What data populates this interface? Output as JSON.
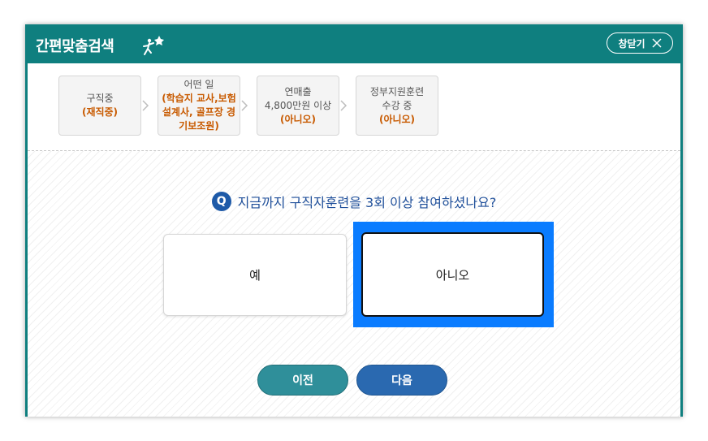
{
  "header": {
    "title": "간편맞춤검색",
    "close_label": "창닫기"
  },
  "steps": [
    {
      "lines": [
        "구직중"
      ],
      "value": "(재직중)"
    },
    {
      "lines": [
        "어떤 일"
      ],
      "value_lines": [
        "(학습지 교사,보험",
        "설계사, 골프장 경",
        "기보조원)"
      ]
    },
    {
      "lines": [
        "연매출",
        "4,800만원 이상"
      ],
      "value": "(아니오)"
    },
    {
      "lines": [
        "정부지원훈련",
        "수강 중"
      ],
      "value": "(아니오)"
    }
  ],
  "question": {
    "badge": "Q",
    "text": "지금까지 구직자훈련을 3회 이상 참여하셨나요?"
  },
  "answers": {
    "yes": "예",
    "no": "아니오",
    "selected": "no"
  },
  "buttons": {
    "prev": "이전",
    "next": "다음"
  },
  "colors": {
    "header": "#0f7f7f",
    "step_value": "#c85a00",
    "question": "#1f4f9a",
    "selection_highlight": "#0a7cff",
    "prev_button": "#2f8f9a",
    "next_button": "#2a69b0"
  }
}
